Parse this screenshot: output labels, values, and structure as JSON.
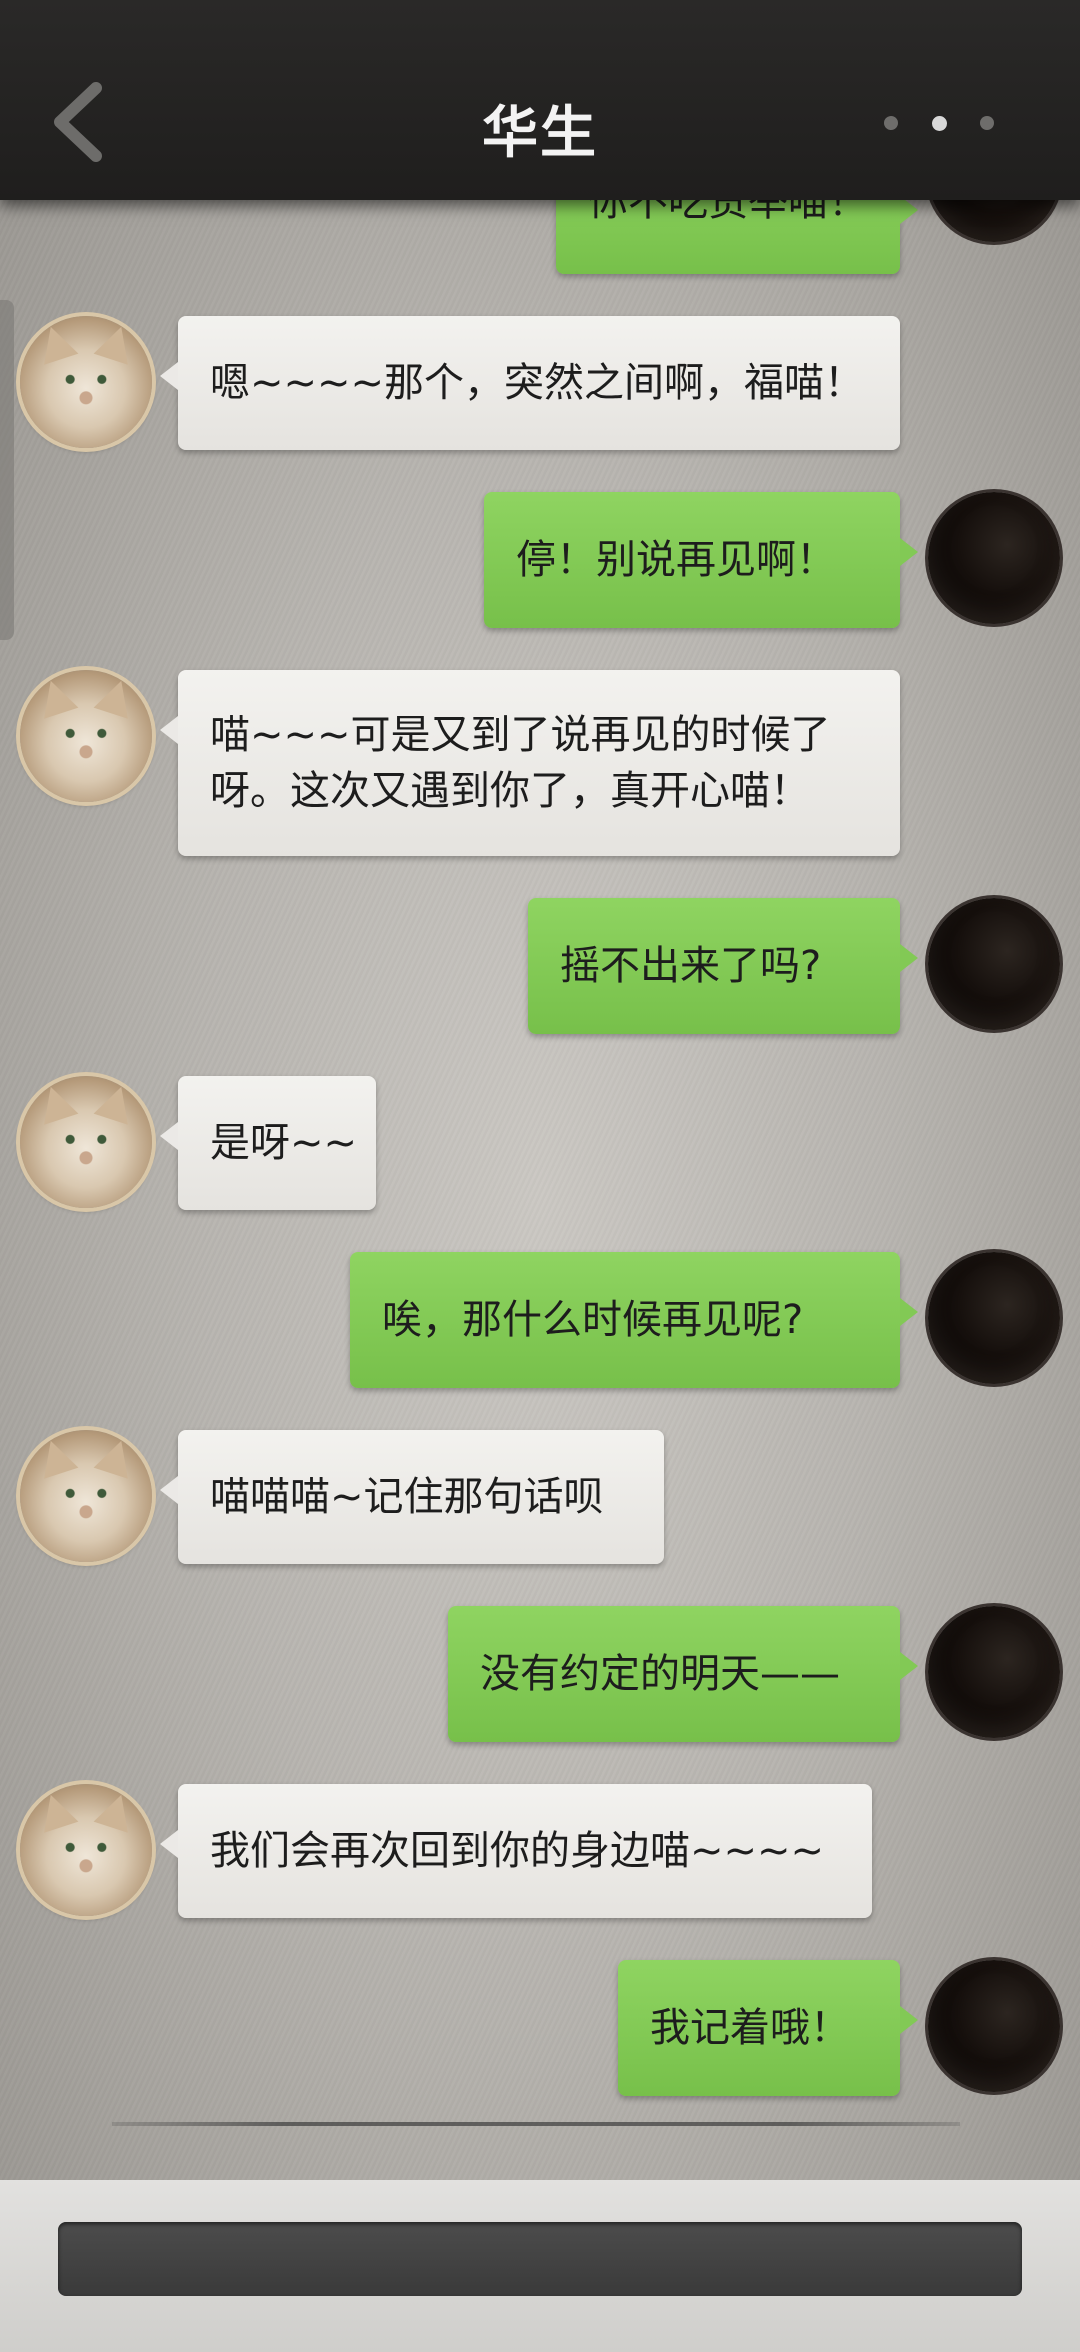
{
  "header": {
    "title": "华生",
    "back_icon": "chevron-left-icon",
    "more_icon": "more-horizontal-icon"
  },
  "messages": [
    {
      "side": "out",
      "text": "你不吃货举喵！"
    },
    {
      "side": "in",
      "text": "嗯~~~~那个，突然之间啊，福喵！"
    },
    {
      "side": "out",
      "text": "停！别说再见啊！"
    },
    {
      "side": "in",
      "text": "喵~~~可是又到了说再见的时候了呀。这次又遇到你了，真开心喵！"
    },
    {
      "side": "out",
      "text": "摇不出来了吗?"
    },
    {
      "side": "in",
      "text": "是呀~~"
    },
    {
      "side": "out",
      "text": "唉，那什么时候再见呢?"
    },
    {
      "side": "in",
      "text": "喵喵喵~记住那句话呗"
    },
    {
      "side": "out",
      "text": "没有约定的明天——"
    },
    {
      "side": "in",
      "text": "我们会再次回到你的身边喵~~~~"
    },
    {
      "side": "out",
      "text": "我记着哦！"
    }
  ],
  "composer": {
    "input_value": ""
  },
  "colors": {
    "outgoing_bubble": "#82c955",
    "incoming_bubble": "#ebe9e6",
    "topbar": "#232221"
  }
}
